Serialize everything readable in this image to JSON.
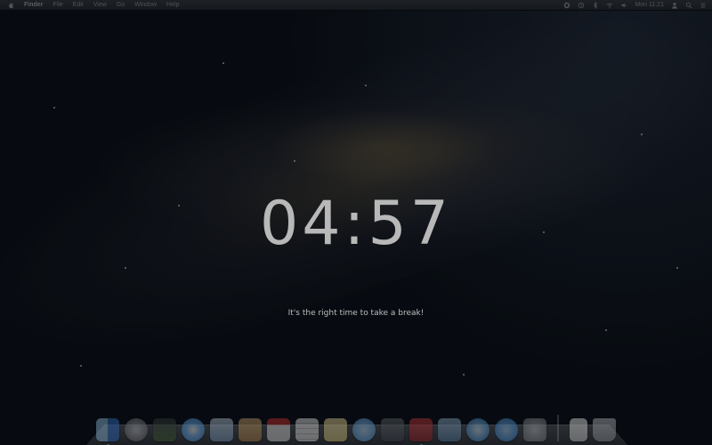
{
  "menubar": {
    "app_name": "Finder",
    "menus": [
      "File",
      "Edit",
      "View",
      "Go",
      "Window",
      "Help"
    ],
    "clock": "Mon 11:21"
  },
  "break_screen": {
    "countdown": "04:57",
    "message": "It's the right time to take a break!"
  },
  "dock": {
    "apps": [
      {
        "icon": "finder-icon",
        "color": "#3a7bd5"
      },
      {
        "icon": "launchpad-icon",
        "color": "#7c7c86"
      },
      {
        "icon": "mission-control-icon",
        "color": "#4a6a3a"
      },
      {
        "icon": "safari-icon",
        "color": "#2f86d6"
      },
      {
        "icon": "mail-icon",
        "color": "#7fa2c8"
      },
      {
        "icon": "contacts-icon",
        "color": "#b98a4e"
      },
      {
        "icon": "calendar-icon",
        "color": "#e8e8e8"
      },
      {
        "icon": "reminders-icon",
        "color": "#f2f2f2"
      },
      {
        "icon": "notes-icon",
        "color": "#e7d48a"
      },
      {
        "icon": "messages-icon",
        "color": "#5aa6e8"
      },
      {
        "icon": "facetime-icon",
        "color": "#444a52"
      },
      {
        "icon": "photo-booth-icon",
        "color": "#a0262a"
      },
      {
        "icon": "iphoto-icon",
        "color": "#5b84a8"
      },
      {
        "icon": "itunes-icon",
        "color": "#3b8fd8"
      },
      {
        "icon": "app-store-icon",
        "color": "#3c8fe0"
      },
      {
        "icon": "system-preferences-icon",
        "color": "#8a8f96"
      },
      {
        "icon": "document-icon",
        "color": "#e0e0e0"
      },
      {
        "icon": "trash-icon",
        "color": "#9aa0a6"
      }
    ]
  }
}
